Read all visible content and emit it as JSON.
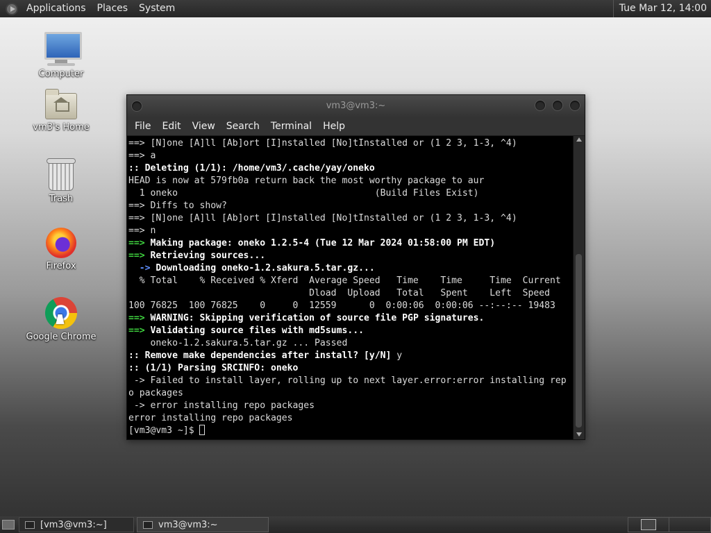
{
  "top_panel": {
    "menus": [
      "Applications",
      "Places",
      "System"
    ],
    "clock": "Tue Mar 12, 14:00"
  },
  "desktop": {
    "icons": [
      {
        "label": "Computer",
        "icon": "computer-icon"
      },
      {
        "label": "vm3's Home",
        "icon": "home-folder-icon"
      },
      {
        "label": "Trash",
        "icon": "trash-icon"
      },
      {
        "label": "Firefox",
        "icon": "firefox-icon"
      },
      {
        "label": "Google Chrome",
        "icon": "chrome-icon"
      }
    ]
  },
  "terminal": {
    "title": "vm3@vm3:~",
    "menu": [
      "File",
      "Edit",
      "View",
      "Search",
      "Terminal",
      "Help"
    ],
    "lines": [
      {
        "parts": [
          {
            "t": "==> [N]one [A]ll [Ab]ort [I]nstalled [No]tInstalled or (1 2 3, 1-3, ^4)",
            "s": ""
          }
        ]
      },
      {
        "parts": [
          {
            "t": "==> a",
            "s": ""
          }
        ]
      },
      {
        "parts": [
          {
            "t": ":: Deleting (1/1): /home/vm3/.cache/yay/oneko",
            "s": "b"
          }
        ]
      },
      {
        "parts": [
          {
            "t": "HEAD is now at 579fb0a return back the most worthy package to aur",
            "s": ""
          }
        ]
      },
      {
        "parts": [
          {
            "t": "  1 oneko                                    (Build Files Exist)",
            "s": ""
          }
        ]
      },
      {
        "parts": [
          {
            "t": "==> Diffs to show?",
            "s": ""
          }
        ]
      },
      {
        "parts": [
          {
            "t": "==> [N]one [A]ll [Ab]ort [I]nstalled [No]tInstalled or (1 2 3, 1-3, ^4)",
            "s": ""
          }
        ]
      },
      {
        "parts": [
          {
            "t": "==> n",
            "s": ""
          }
        ]
      },
      {
        "parts": [
          {
            "t": "==> ",
            "s": "g"
          },
          {
            "t": "Making package: oneko 1.2.5-4 (Tue 12 Mar 2024 01:58:00 PM EDT)",
            "s": "b"
          }
        ]
      },
      {
        "parts": [
          {
            "t": "==> ",
            "s": "g"
          },
          {
            "t": "Retrieving sources...",
            "s": "b"
          }
        ]
      },
      {
        "parts": [
          {
            "t": "  -> ",
            "s": "bl"
          },
          {
            "t": "Downloading oneko-1.2.sakura.5.tar.gz...",
            "s": "b"
          }
        ]
      },
      {
        "parts": [
          {
            "t": "  % Total    % Received % Xferd  Average Speed   Time    Time     Time  Current",
            "s": ""
          }
        ]
      },
      {
        "parts": [
          {
            "t": "                                 Dload  Upload   Total   Spent    Left  Speed",
            "s": ""
          }
        ]
      },
      {
        "parts": [
          {
            "t": "100 76825  100 76825    0     0  12559      0  0:00:06  0:00:06 --:--:-- 19483",
            "s": ""
          }
        ]
      },
      {
        "parts": [
          {
            "t": "==> ",
            "s": "g"
          },
          {
            "t": "WARNING: ",
            "s": "b"
          },
          {
            "t": "Skipping verification of source file PGP signatures.",
            "s": "b"
          }
        ]
      },
      {
        "parts": [
          {
            "t": "==> ",
            "s": "g"
          },
          {
            "t": "Validating source files with md5sums...",
            "s": "b"
          }
        ]
      },
      {
        "parts": [
          {
            "t": "    oneko-1.2.sakura.5.tar.gz ... Passed",
            "s": ""
          }
        ]
      },
      {
        "parts": [
          {
            "t": ":: Remove make dependencies after install? [y/N] ",
            "s": "b"
          },
          {
            "t": "y",
            "s": ""
          }
        ]
      },
      {
        "parts": [
          {
            "t": ":: (1/1) Parsing SRCINFO: oneko",
            "s": "b"
          }
        ]
      },
      {
        "parts": [
          {
            "t": " -> Failed to install layer, rolling up to next layer.error:error installing rep",
            "s": ""
          }
        ]
      },
      {
        "parts": [
          {
            "t": "o packages",
            "s": ""
          }
        ]
      },
      {
        "parts": [
          {
            "t": " -> error installing repo packages",
            "s": ""
          }
        ]
      },
      {
        "parts": [
          {
            "t": "error installing repo packages",
            "s": ""
          }
        ]
      }
    ],
    "prompt": "[vm3@vm3 ~]$ "
  },
  "taskbar": {
    "items": [
      "[vm3@vm3:~]",
      "vm3@vm3:~"
    ]
  }
}
